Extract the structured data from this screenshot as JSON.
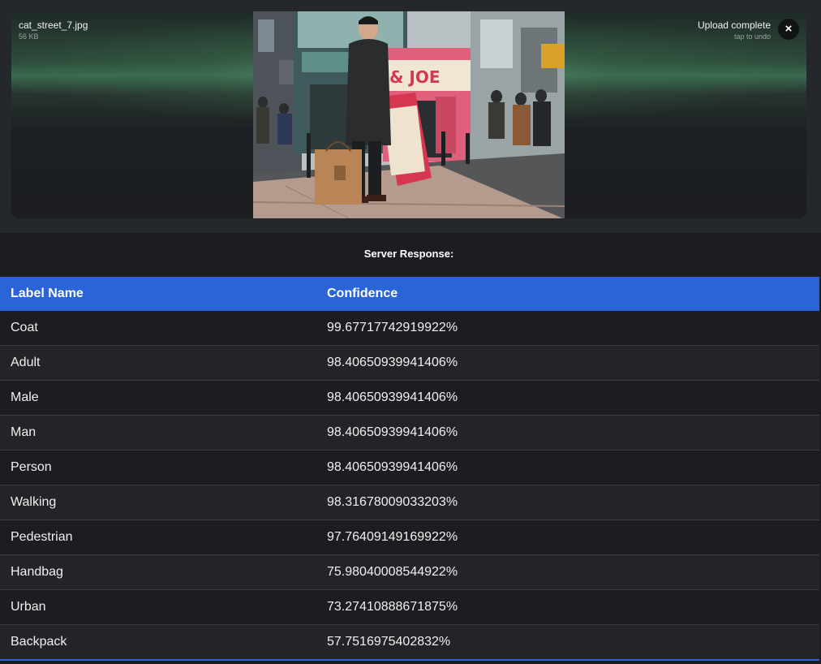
{
  "upload": {
    "file_name": "cat_street_7.jpg",
    "file_size": "56 KB",
    "status": "Upload complete",
    "status_hint": "tap to undo",
    "close_icon": "×"
  },
  "response": {
    "title": "Server Response:"
  },
  "table": {
    "headers": [
      "Label Name",
      "Confidence"
    ],
    "rows": [
      {
        "label": "Coat",
        "confidence": "99.67717742919922%"
      },
      {
        "label": "Adult",
        "confidence": "98.40650939941406%"
      },
      {
        "label": "Male",
        "confidence": "98.40650939941406%"
      },
      {
        "label": "Man",
        "confidence": "98.40650939941406%"
      },
      {
        "label": "Person",
        "confidence": "98.40650939941406%"
      },
      {
        "label": "Walking",
        "confidence": "98.31678009033203%"
      },
      {
        "label": "Pedestrian",
        "confidence": "97.76409149169922%"
      },
      {
        "label": "Handbag",
        "confidence": "75.98040008544922%"
      },
      {
        "label": "Urban",
        "confidence": "73.27410888671875%"
      },
      {
        "label": "Backpack",
        "confidence": "57.7516975402832%"
      }
    ]
  },
  "photo": {
    "sign_text": "& JOE"
  },
  "colors": {
    "accent": "#2a64d6",
    "background": "#1b1d20",
    "panel": "#24272b"
  }
}
